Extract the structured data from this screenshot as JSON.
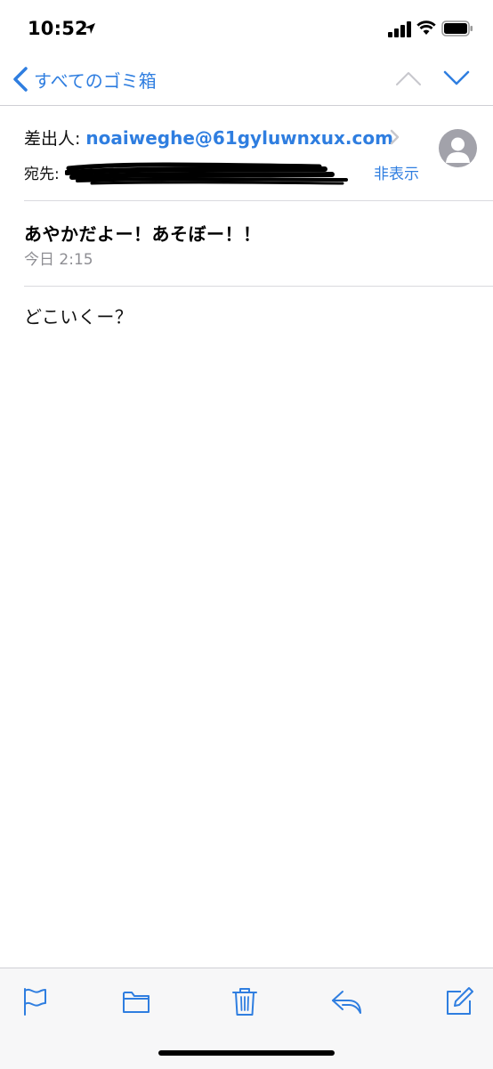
{
  "status_bar": {
    "time": "10:52"
  },
  "nav": {
    "back_label": "すべてのゴミ箱"
  },
  "message": {
    "from_label": "差出人:",
    "from_address": "noaiweghe@61gyluwnxux.com",
    "to_label": "宛先:",
    "hide_label": "非表示",
    "subject": "あやかだよー！あそぼー！！",
    "date": "今日 2:15",
    "body": "どこいくー？"
  },
  "colors": {
    "accent": "#2f7ee0",
    "secondary_text": "#8e8e93",
    "avatar_bg": "#a2a2aa"
  },
  "icons": {
    "toolbar": [
      "flag-icon",
      "folder-icon",
      "trash-icon",
      "reply-icon",
      "compose-icon"
    ]
  }
}
